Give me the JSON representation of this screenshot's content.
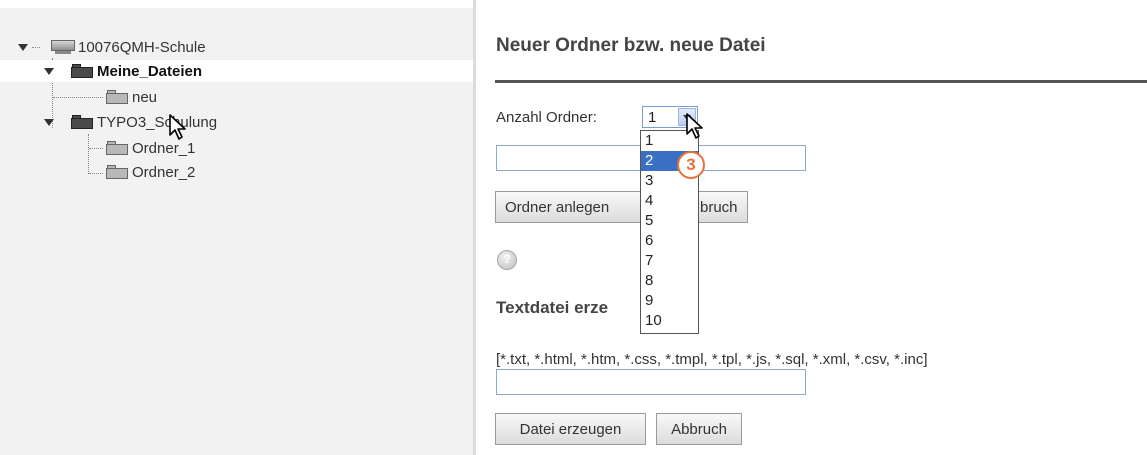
{
  "tree": {
    "root": {
      "label": "10076QMH-Schule",
      "icon": "server-icon"
    },
    "items": [
      {
        "label": "Meine_Dateien",
        "icon": "folder-icon",
        "selected": true
      },
      {
        "label": "neu",
        "icon": "folder-icon"
      },
      {
        "label": "TYPO3_Schulung",
        "icon": "folder-icon"
      },
      {
        "label": "Ordner_1",
        "icon": "folder-icon"
      },
      {
        "label": "Ordner_2",
        "icon": "folder-icon"
      }
    ]
  },
  "main": {
    "title": "Neuer Ordner bzw. neue Datei",
    "folder_count_label": "Anzahl Ordner:",
    "folder_count_value": "1",
    "create_folder_button": "Ordner anlegen",
    "cancel_button_partial": "bruch",
    "section_heading": "Textdatei erze",
    "file_types": "[*.txt, *.html, *.htm, *.css, *.tmpl, *.tpl, *.js, *.sql, *.xml, *.csv, *.inc]",
    "create_file_button": "Datei erzeugen",
    "cancel_button": "Abbruch"
  },
  "dropdown": {
    "options": [
      "1",
      "2",
      "3",
      "4",
      "5",
      "6",
      "7",
      "8",
      "9",
      "10"
    ],
    "highlighted": "2"
  },
  "annotation": {
    "step": "3",
    "color": "#e8713a"
  },
  "colors": {
    "highlight": "#3a6fc4",
    "field_border": "#8fa8cc"
  }
}
